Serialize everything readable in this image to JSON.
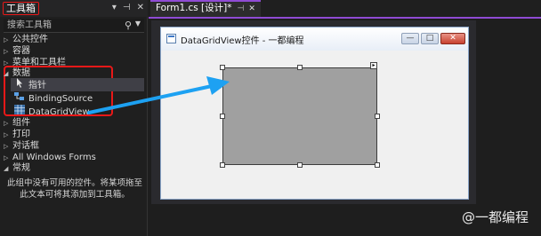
{
  "toolbox": {
    "title": "工具箱",
    "header_icons": [
      "▾",
      "⊣",
      "✕"
    ],
    "search_placeholder": "搜索工具箱",
    "categories_top": [
      "公共控件",
      "容器",
      "菜单和工具栏"
    ],
    "data_category": "数据",
    "data_items": [
      {
        "label": "指针",
        "icon": "pointer-icon"
      },
      {
        "label": "BindingSource",
        "icon": "bindingsource-icon"
      },
      {
        "label": "DataGridView",
        "icon": "datagridview-icon"
      }
    ],
    "categories_bottom": [
      "组件",
      "打印",
      "对话框",
      "All Windows Forms"
    ],
    "general_category": "常规",
    "empty_message": "此组中没有可用的控件。将某项拖至此文本可将其添加到工具箱。"
  },
  "tabs": [
    {
      "label": "Form1.cs [设计]*",
      "active": true
    }
  ],
  "form": {
    "caption": "DataGridView控件 - 一都编程",
    "controls": [
      "—",
      "□",
      "✕"
    ]
  },
  "watermark": "@一都编程",
  "colors": {
    "highlight_red": "#e81818",
    "arrow_blue": "#1da1f2",
    "tab_accent": "#8f4bd4",
    "grid_gray": "#a0a0a0"
  }
}
